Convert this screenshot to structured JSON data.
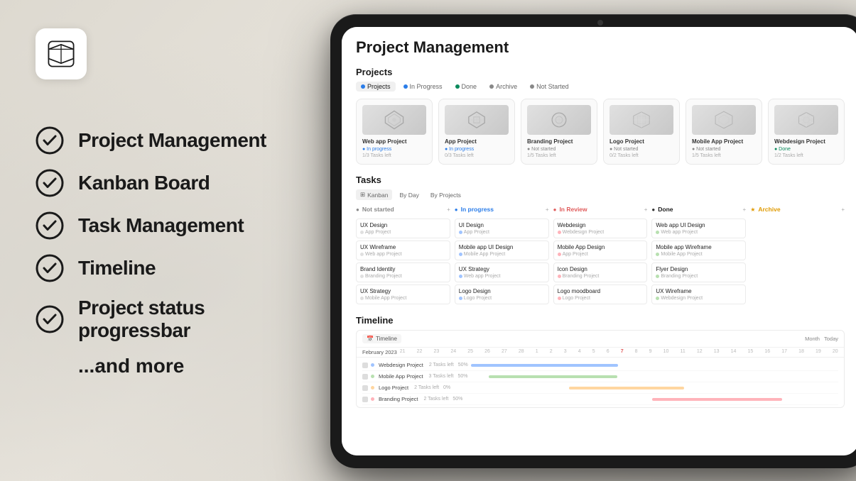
{
  "background": {
    "color": "#e4e0d8"
  },
  "logo": {
    "alt": "Notion Logo"
  },
  "features": [
    {
      "id": "project-management",
      "label": "Project Management"
    },
    {
      "id": "kanban-board",
      "label": "Kanban Board"
    },
    {
      "id": "task-management",
      "label": "Task Management"
    },
    {
      "id": "timeline",
      "label": "Timeline"
    },
    {
      "id": "progress-bar",
      "label": "Project status progressbar"
    }
  ],
  "and_more": "...and more",
  "notion_app": {
    "page_title": "Project Management",
    "projects_section": {
      "title": "Projects",
      "tabs": [
        {
          "label": "Projects",
          "active": true,
          "dot_color": "#2b7de9"
        },
        {
          "label": "In Progress",
          "active": false,
          "dot_color": "#2b7de9"
        },
        {
          "label": "Done",
          "active": false,
          "dot_color": "#0a8a5c"
        },
        {
          "label": "Archive",
          "active": false,
          "dot_color": "#888"
        },
        {
          "label": "Not Started",
          "active": false,
          "dot_color": "#888"
        }
      ],
      "projects": [
        {
          "name": "Web app Project",
          "status": "in-progress",
          "status_label": "In progress",
          "tasks": "1/3 Tasks left"
        },
        {
          "name": "App Project",
          "status": "in-progress",
          "status_label": "In progress",
          "tasks": "0/3 Tasks left"
        },
        {
          "name": "Branding Project",
          "status": "not-started",
          "status_label": "Not started",
          "tasks": "1/5 Tasks left"
        },
        {
          "name": "Logo Project",
          "status": "not-started",
          "status_label": "Not started",
          "tasks": "0/2 Tasks left"
        },
        {
          "name": "Mobile App Project",
          "status": "not-started",
          "status_label": "Not started",
          "tasks": "1/5 Tasks left"
        },
        {
          "name": "Webdesign Project",
          "status": "done",
          "status_label": "Done",
          "tasks": "1/2 Tasks left"
        }
      ]
    },
    "tasks_section": {
      "title": "Tasks",
      "tabs": [
        {
          "label": "Kanban",
          "active": true
        },
        {
          "label": "By Day",
          "active": false
        },
        {
          "label": "By Projects",
          "active": false
        }
      ],
      "columns": [
        {
          "id": "not-started",
          "title": "Not started",
          "class": "col-not-started",
          "tasks": [
            {
              "name": "UX Design",
              "project": "App Project"
            },
            {
              "name": "UX Wireframe",
              "project": "Web app Project"
            },
            {
              "name": "Brand Identity",
              "project": "Branding Project"
            },
            {
              "name": "UX Strategy",
              "project": "Mobile App Project"
            }
          ]
        },
        {
          "id": "in-progress",
          "title": "In progress",
          "class": "col-in-progress",
          "tasks": [
            {
              "name": "UI Design",
              "project": "App Project"
            },
            {
              "name": "Mobile app UI Design",
              "project": "Mobile App Project"
            },
            {
              "name": "UX Strategy",
              "project": "Web app Project"
            },
            {
              "name": "Logo Design",
              "project": "Logo Project"
            }
          ]
        },
        {
          "id": "in-review",
          "title": "In Review",
          "class": "col-in-review",
          "tasks": [
            {
              "name": "Webdesign",
              "project": "Webdesign Project"
            },
            {
              "name": "Mobile App Design",
              "project": "App Project"
            },
            {
              "name": "Icon Design",
              "project": "Branding Project"
            },
            {
              "name": "Logo moodboard",
              "project": "Logo Project"
            }
          ]
        },
        {
          "id": "done",
          "title": "Done",
          "class": "col-done",
          "tasks": [
            {
              "name": "Web app UI Design",
              "project": "Web app Project"
            },
            {
              "name": "Mobile app Wireframe",
              "project": "Mobile App Project"
            },
            {
              "name": "Flyer Design",
              "project": "Branding Project"
            },
            {
              "name": "UX Wireframe",
              "project": "Webdesign Project"
            }
          ]
        },
        {
          "id": "archive",
          "title": "Archive",
          "class": "col-archive",
          "tasks": []
        }
      ]
    },
    "timeline_section": {
      "title": "Timeline",
      "tab_label": "Timeline",
      "month_label": "Month",
      "today_label": "Today",
      "dates": [
        "21",
        "22",
        "23",
        "24",
        "25",
        "26",
        "27",
        "28",
        "1",
        "2",
        "3",
        "4",
        "5",
        "6",
        "7",
        "8",
        "9",
        "10",
        "11",
        "12",
        "13",
        "14",
        "15",
        "16",
        "17",
        "18",
        "19",
        "20"
      ],
      "rows": [
        {
          "name": "Webdesign Project",
          "tasks": "2 Tasks left",
          "pct": "50%",
          "bar_class": "bar-webdesign"
        },
        {
          "name": "Mobile App Project",
          "tasks": "3 Tasks left",
          "pct": "50%",
          "bar_class": "bar-mobile"
        },
        {
          "name": "Logo Project",
          "tasks": "2 Tasks left",
          "pct": "0%",
          "bar_class": "bar-logo"
        },
        {
          "name": "Branding Project",
          "tasks": "2 Tasks left",
          "pct": "50%",
          "bar_class": "bar-branding"
        }
      ]
    }
  }
}
